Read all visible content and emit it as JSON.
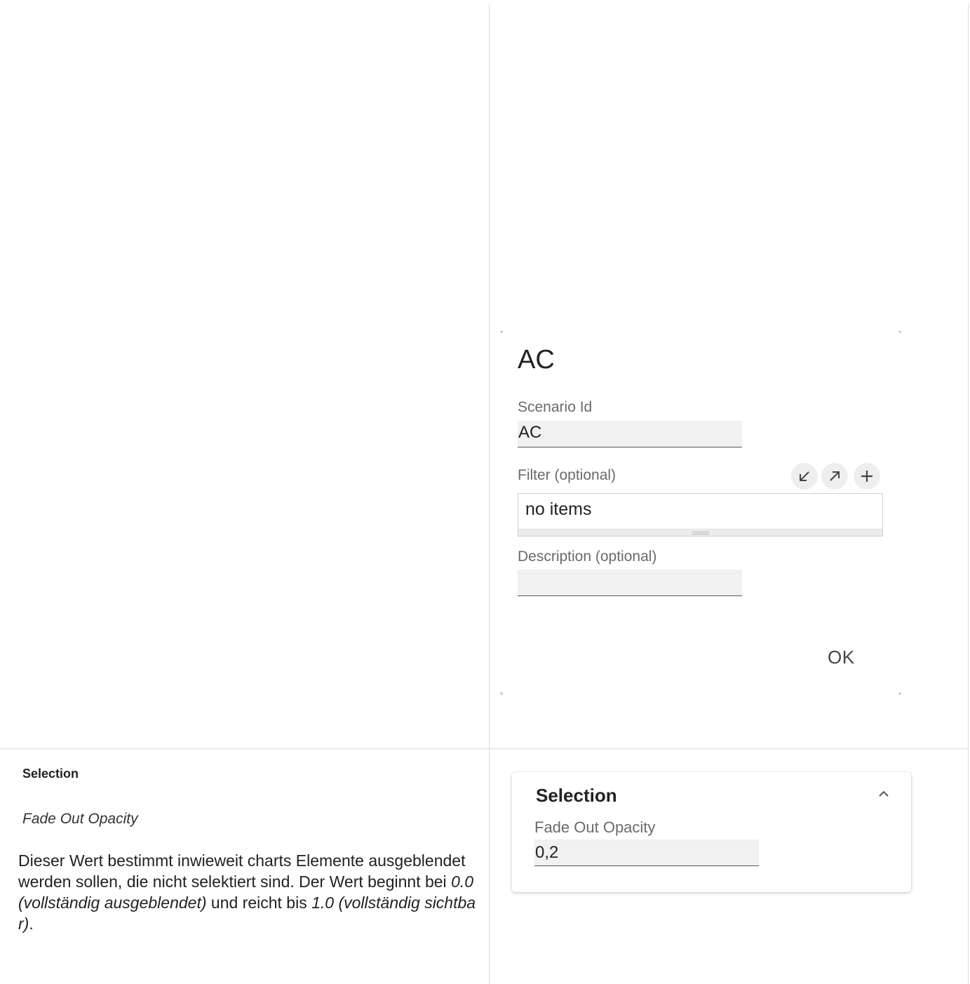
{
  "dialog": {
    "title": "AC",
    "scenario_label": "Scenario Id",
    "scenario_value": "AC",
    "filter_label": "Filter (optional)",
    "filter_value": "no items",
    "filter_icons": [
      "collapse-icon",
      "expand-icon",
      "plus-icon"
    ],
    "description_label": "Description (optional)",
    "description_value": "",
    "ok_label": "OK"
  },
  "doc": {
    "heading": "Selection",
    "subheading": "Fade Out Opacity",
    "text_1": "Dieser Wert bestimmt inwieweit charts Elemente ausgeblendet werden sollen, die nicht selektiert sind. Der Wert beginnt bei ",
    "em_1": "0.0 (vollständig ausgeblendet)",
    "text_2": " und reicht bis ",
    "em_2": "1.0 (vollständig sichtbar)",
    "text_3": "."
  },
  "card": {
    "title": "Selection",
    "field_label": "Fade Out Opacity",
    "field_value": "0,2",
    "chevron_icon": "chevron-up-icon"
  }
}
